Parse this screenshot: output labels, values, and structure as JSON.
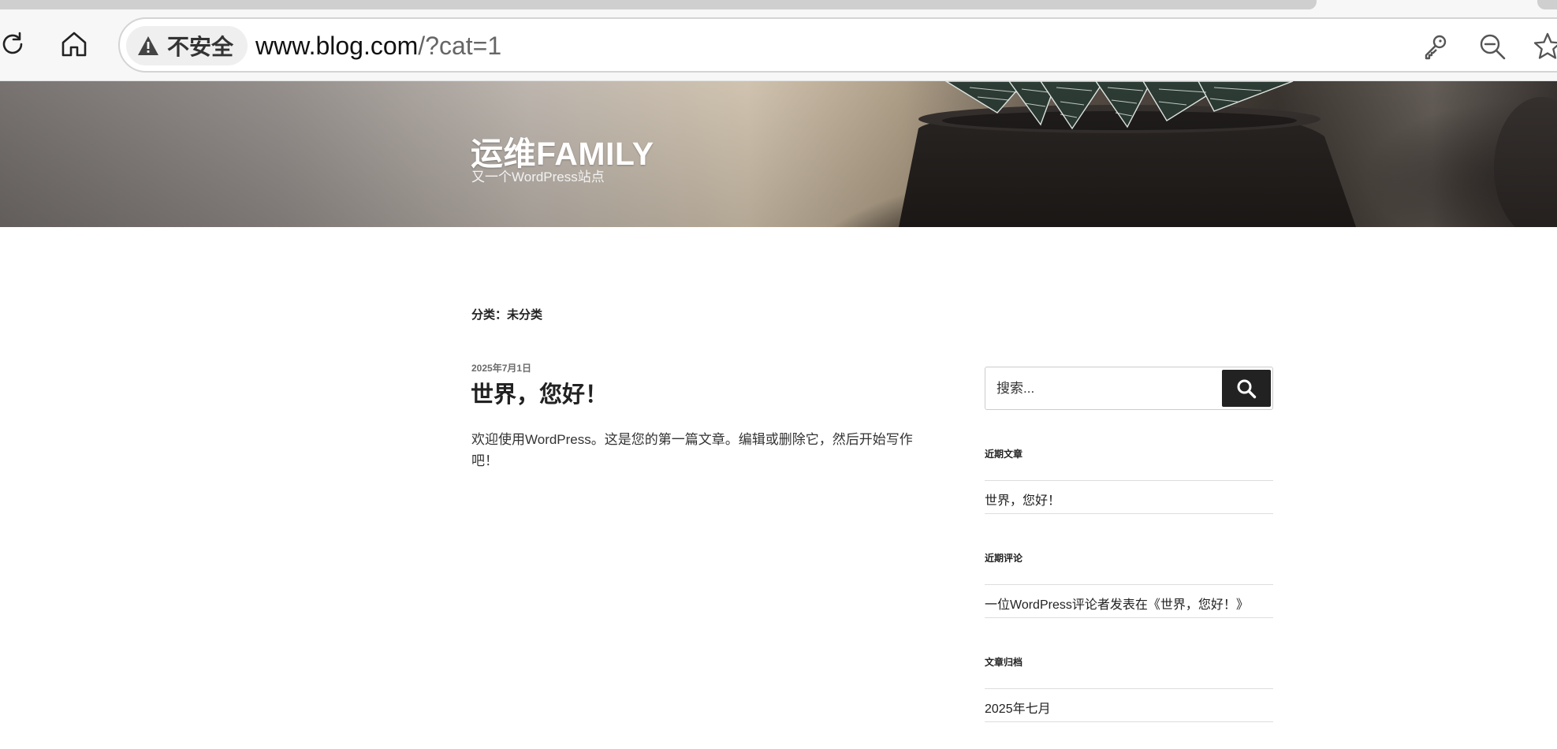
{
  "browser": {
    "security_label": "不安全",
    "url_host": "www.blog.com",
    "url_rest": "/?cat=1",
    "icons": [
      "reload-icon",
      "home-icon",
      "warning-icon",
      "key-icon",
      "zoom-out-icon",
      "star-icon"
    ]
  },
  "site": {
    "title": "运维FAMILY",
    "tagline": "又一个WordPress站点"
  },
  "archive": {
    "title": "分类：未分类"
  },
  "post": {
    "date": "2025年7月1日",
    "title": "世界，您好！",
    "excerpt": "欢迎使用WordPress。这是您的第一篇文章。编辑或删除它，然后开始写作吧！"
  },
  "sidebar": {
    "search_placeholder": "搜索...",
    "search_icon": "search-icon",
    "recent_posts": {
      "title": "近期文章",
      "items": [
        "世界，您好！"
      ]
    },
    "recent_comments": {
      "title": "近期评论",
      "items": [
        "一位WordPress评论者发表在《世界，您好！》"
      ]
    },
    "archives": {
      "title": "文章归档",
      "items": [
        "2025年七月"
      ]
    }
  },
  "colors": {
    "text": "#222222",
    "search_button": "#222222",
    "divider": "#dddddd",
    "header_text": "#ffffff"
  }
}
